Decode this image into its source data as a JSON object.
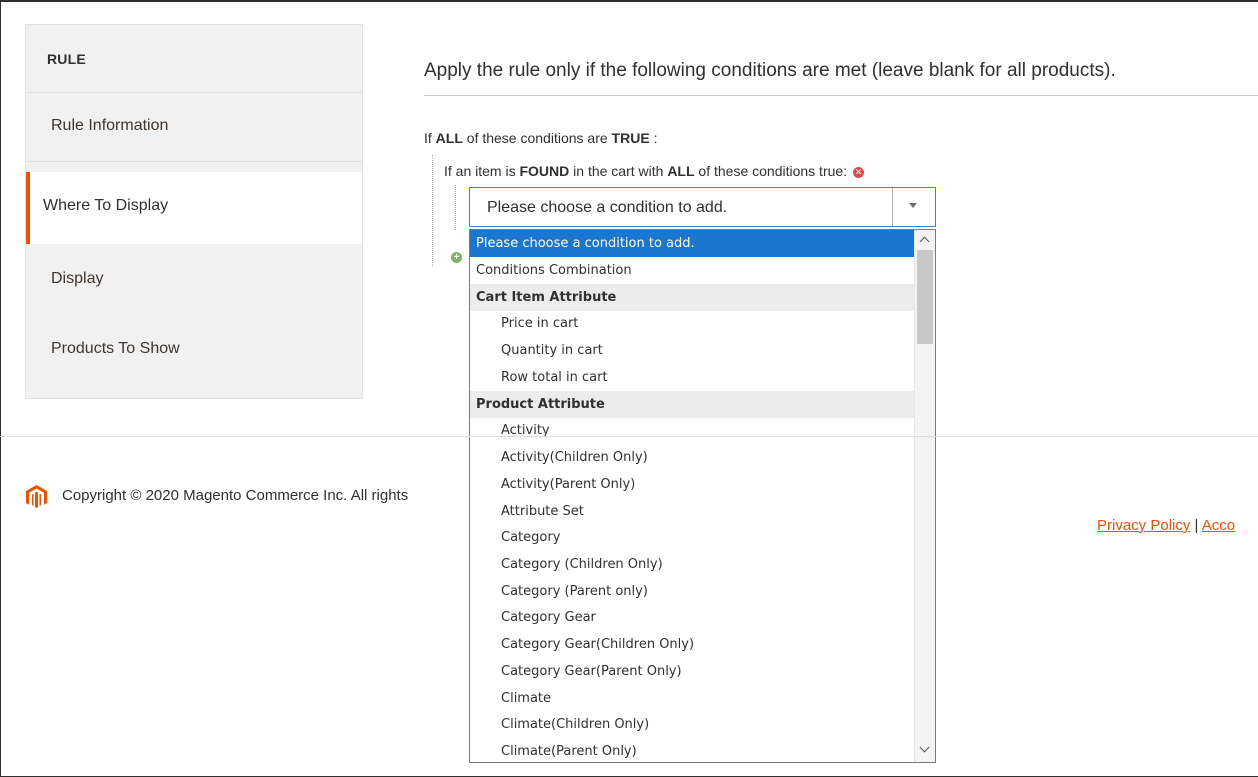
{
  "sidebar": {
    "heading": "RULE",
    "items": [
      {
        "label": "Rule Information"
      },
      {
        "label": "Where To Display"
      },
      {
        "label": "Display"
      },
      {
        "label": "Products To Show"
      }
    ]
  },
  "main": {
    "section_title": "Apply the rule only if the following conditions are met (leave blank for all products).",
    "condition_root": {
      "prefix": "If",
      "aggregator": "ALL",
      "middle": "of these conditions are",
      "value": "TRUE",
      "suffix": ":"
    },
    "condition_found": {
      "prefix": "If an item is",
      "found": "FOUND",
      "middle": "in the cart with",
      "aggregator": "ALL",
      "suffix": "of these conditions true:"
    },
    "select_value": "Please choose a condition to add."
  },
  "dropdown": {
    "options": [
      {
        "label": "Please choose a condition to add.",
        "type": "option",
        "level": 0,
        "selected": true
      },
      {
        "label": "Conditions Combination",
        "type": "option",
        "level": 0
      },
      {
        "label": "Cart Item Attribute",
        "type": "group"
      },
      {
        "label": "Price in cart",
        "type": "option",
        "level": 1
      },
      {
        "label": "Quantity in cart",
        "type": "option",
        "level": 1
      },
      {
        "label": "Row total in cart",
        "type": "option",
        "level": 1
      },
      {
        "label": "Product Attribute",
        "type": "group"
      },
      {
        "label": "Activity",
        "type": "option",
        "level": 1
      },
      {
        "label": "Activity(Children Only)",
        "type": "option",
        "level": 1
      },
      {
        "label": "Activity(Parent Only)",
        "type": "option",
        "level": 1
      },
      {
        "label": "Attribute Set",
        "type": "option",
        "level": 1
      },
      {
        "label": "Category",
        "type": "option",
        "level": 1
      },
      {
        "label": "Category (Children Only)",
        "type": "option",
        "level": 1
      },
      {
        "label": "Category (Parent only)",
        "type": "option",
        "level": 1
      },
      {
        "label": "Category Gear",
        "type": "option",
        "level": 1
      },
      {
        "label": "Category Gear(Children Only)",
        "type": "option",
        "level": 1
      },
      {
        "label": "Category Gear(Parent Only)",
        "type": "option",
        "level": 1
      },
      {
        "label": "Climate",
        "type": "option",
        "level": 1
      },
      {
        "label": "Climate(Children Only)",
        "type": "option",
        "level": 1
      },
      {
        "label": "Climate(Parent Only)",
        "type": "option",
        "level": 1
      }
    ]
  },
  "footer": {
    "copyright": "Copyright © 2020 Magento Commerce Inc. All rights",
    "privacy_link": "Privacy Policy",
    "separator": "|",
    "account_link": "Acco"
  },
  "colors": {
    "accent": "#eb5202",
    "selected_option": "#1b76d0",
    "select_border": "#3d7fd6"
  }
}
